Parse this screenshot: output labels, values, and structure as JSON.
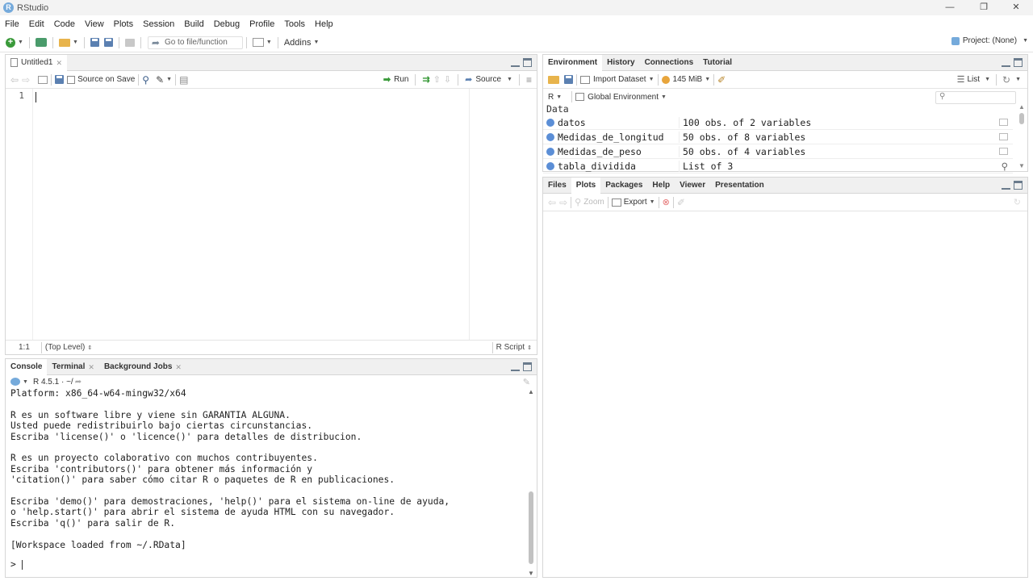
{
  "window": {
    "title": "RStudio",
    "app_icon": "R"
  },
  "menu": [
    "File",
    "Edit",
    "Code",
    "View",
    "Plots",
    "Session",
    "Build",
    "Debug",
    "Profile",
    "Tools",
    "Help"
  ],
  "toolbar": {
    "goto_placeholder": "Go to file/function",
    "addins": "Addins",
    "project": "Project: (None)"
  },
  "editor": {
    "tab_label": "Untitled1",
    "source_on_save": "Source on Save",
    "run": "Run",
    "source": "Source",
    "line_number": "1",
    "position": "1:1",
    "scope": "(Top Level)",
    "file_type": "R Script"
  },
  "console": {
    "tabs": [
      "Console",
      "Terminal",
      "Background Jobs"
    ],
    "r_version": "R 4.5.1 · ~/",
    "lines": [
      "Platform: x86_64-w64-mingw32/x64",
      "",
      "R es un software libre y viene sin GARANTIA ALGUNA.",
      "Usted puede redistribuirlo bajo ciertas circunstancias.",
      "Escriba 'license()' o 'licence()' para detalles de distribucion.",
      "",
      "R es un proyecto colaborativo con muchos contribuyentes.",
      "Escriba 'contributors()' para obtener más información y",
      "'citation()' para saber cómo citar R o paquetes de R en publicaciones.",
      "",
      "Escriba 'demo()' para demostraciones, 'help()' para el sistema on-line de ayuda,",
      "o 'help.start()' para abrir el sistema de ayuda HTML con su navegador.",
      "Escriba 'q()' para salir de R.",
      "",
      "[Workspace loaded from ~/.RData]"
    ],
    "prompt": ">"
  },
  "environment": {
    "tabs": [
      "Environment",
      "History",
      "Connections",
      "Tutorial"
    ],
    "import_dataset": "Import Dataset",
    "memory": "145 MiB",
    "list_mode": "List",
    "language": "R",
    "scope": "Global Environment",
    "section": "Data",
    "rows": [
      {
        "name": "datos",
        "value": "100 obs. of 2 variables"
      },
      {
        "name": "Medidas_de_longitud",
        "value": "50 obs. of 8 variables"
      },
      {
        "name": "Medidas_de_peso",
        "value": "50 obs. of 4 variables"
      },
      {
        "name": "tabla_dividida",
        "value": "List of  3"
      }
    ]
  },
  "files": {
    "tabs": [
      "Files",
      "Plots",
      "Packages",
      "Help",
      "Viewer",
      "Presentation"
    ],
    "zoom": "Zoom",
    "export": "Export"
  }
}
